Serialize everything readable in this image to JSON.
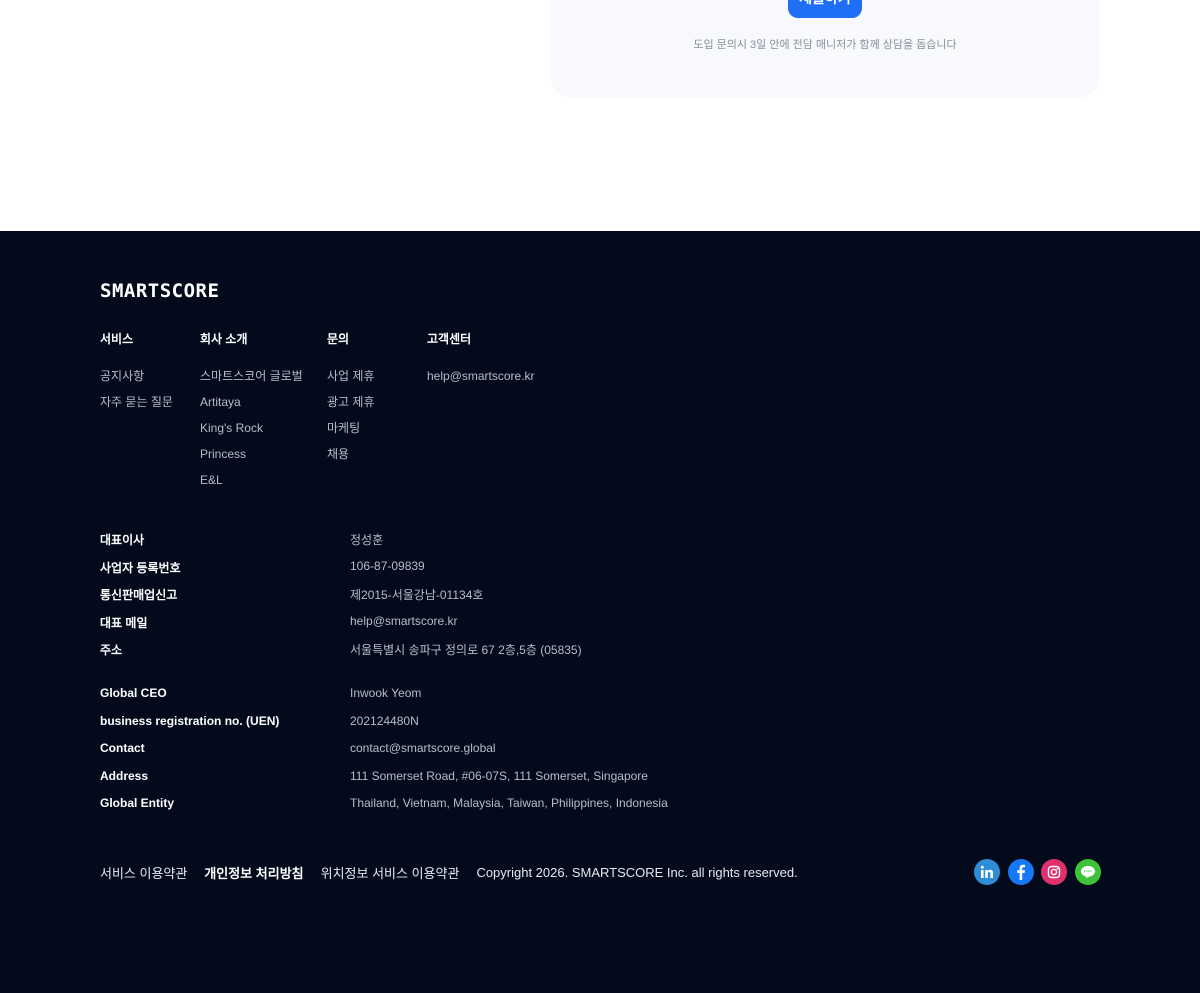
{
  "top": {
    "submit_label": "제출하기",
    "submit_note": "도입 문의시 3일 안에 전담 매니저가 함께 상담을 돕습니다"
  },
  "footer": {
    "logo": "SMARTSCORE",
    "menus": [
      {
        "title": "서비스",
        "items": [
          "공지사항",
          "자주 묻는 질문"
        ]
      },
      {
        "title": "회사 소개",
        "items": [
          "스마트스코어 글로벌",
          "Artitaya",
          "King's Rock",
          "Princess",
          "E&L"
        ]
      },
      {
        "title": "문의",
        "items": [
          "사업 제휴",
          "광고 제휴",
          "마케팅",
          "채용"
        ]
      },
      {
        "title": "고객센터",
        "items": [
          "help@smartscore.kr"
        ]
      }
    ],
    "korea_info": [
      {
        "k": "대표이사",
        "v": "정성훈"
      },
      {
        "k": "사업자 등록번호",
        "v": "106-87-09839"
      },
      {
        "k": "통신판매업신고",
        "v": "제2015-서울강남-01134호"
      },
      {
        "k": "대표 메일",
        "v": "help@smartscore.kr"
      },
      {
        "k": "주소",
        "v": "서울특별시 송파구 정의로 67 2층,5층 (05835)"
      }
    ],
    "global_info": [
      {
        "k": "Global CEO",
        "v": "Inwook Yeom"
      },
      {
        "k": "business registration no. (UEN)",
        "v": "202124480N"
      },
      {
        "k": "Contact",
        "v": "contact@smartscore.global"
      },
      {
        "k": "Address",
        "v": "111 Somerset Road, #06-07S, 111 Somerset, Singapore"
      },
      {
        "k": "Global Entity",
        "v": "Thailand, Vietnam, Malaysia, Taiwan, Philippines, Indonesia"
      }
    ],
    "links": {
      "terms": "서비스 이용약관",
      "privacy": "개인정보 처리방침",
      "location_terms": "위치정보 서비스 이용약관",
      "copyright": "Copyright 2026. SMARTSCORE Inc. all rights reserved."
    },
    "socials": {
      "linkedin_icon": "linkedin-icon",
      "facebook_icon": "facebook-icon",
      "instagram_icon": "instagram-icon",
      "line_icon": "line-icon"
    }
  }
}
